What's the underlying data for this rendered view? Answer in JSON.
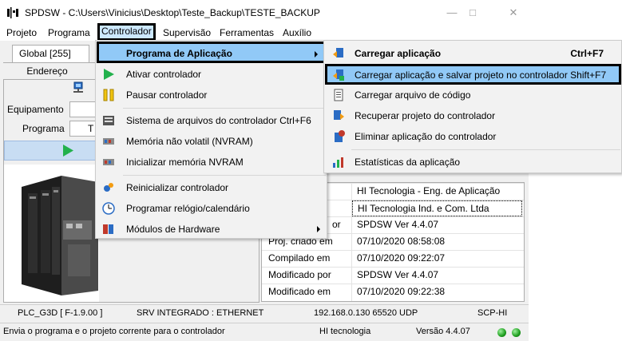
{
  "window": {
    "title": "SPDSW - C:\\Users\\Vinicius\\Desktop\\Teste_Backup\\TESTE_BACKUP",
    "icon": "app-logo-icon"
  },
  "menubar": {
    "items": [
      "Projeto",
      "Programa",
      "Controlador",
      "Supervisão",
      "Ferramentas",
      "Auxílio"
    ]
  },
  "left_panel": {
    "tab_label": "Global [255]",
    "endereco_label": "Endereço",
    "equipamento_label": "Equipamento",
    "programa_label": "Programa",
    "programa_value": "T"
  },
  "info": {
    "rows": [
      {
        "key": "",
        "value": "HI Tecnologia - Eng. de Aplicação"
      },
      {
        "key": "",
        "value": "HI Tecnologia Ind. e Com. Ltda"
      },
      {
        "key": "or",
        "value": "SPDSW Ver 4.4.07"
      },
      {
        "key": "Proj. criado em",
        "value": "07/10/2020 08:58:08"
      },
      {
        "key": "Compilado em",
        "value": "07/10/2020 09:22:07"
      },
      {
        "key": "Modificado por",
        "value": "SPDSW Ver 4.4.07"
      },
      {
        "key": "Modificado em",
        "value": "07/10/2020 09:22:38"
      }
    ]
  },
  "status1": {
    "plc": "PLC_G3D [ F-1.9.00 ]",
    "server": "SRV INTEGRADO : ETHERNET",
    "address": "192.168.0.130 65520 UDP",
    "protocol": "SCP-HI"
  },
  "status2": {
    "message": "Envia o programa e o projeto corrente para o controlador",
    "company": "HI tecnologia",
    "version": "Versão 4.4.07"
  },
  "dropdown": {
    "items": [
      {
        "label": "Programa de Aplicação",
        "icon": "",
        "submenu": true
      },
      {
        "label": "Ativar controlador",
        "icon": "play-icon"
      },
      {
        "label": "Pausar controlador",
        "icon": "pause-icon"
      },
      {
        "label": "Sistema de arquivos do controlador Ctrl+F6",
        "icon": "file-system-icon"
      },
      {
        "label": "Memória não volatil (NVRAM)",
        "icon": "memory-icon"
      },
      {
        "label": "Inicializar memória NVRAM",
        "icon": "memory-init-icon"
      },
      {
        "label": "Reinicializar controlador",
        "icon": "restart-icon"
      },
      {
        "label": "Programar relógio/calendário",
        "icon": "clock-icon"
      },
      {
        "label": "Módulos de Hardware",
        "icon": "hardware-modules-icon",
        "submenu": true
      }
    ]
  },
  "submenu": {
    "items": [
      {
        "label": "Carregar aplicação",
        "shortcut": "Ctrl+F7",
        "icon": "load-app-icon"
      },
      {
        "label": "Carregar aplicação e salvar projeto no controlador Shift+F7",
        "shortcut": "",
        "icon": "load-save-icon"
      },
      {
        "label": "Carregar arquivo de código",
        "shortcut": "",
        "icon": "load-code-icon"
      },
      {
        "label": "Recuperar projeto do controlador",
        "shortcut": "",
        "icon": "recover-project-icon"
      },
      {
        "label": "Eliminar aplicação do controlador",
        "shortcut": "",
        "icon": "delete-app-icon"
      },
      {
        "label": "Estatísticas da aplicação",
        "shortcut": "",
        "icon": "statistics-icon"
      }
    ]
  },
  "colors": {
    "highlight": "#91c9f7",
    "menu_bg": "#f2f2f2",
    "run_green": "#22b14c"
  }
}
